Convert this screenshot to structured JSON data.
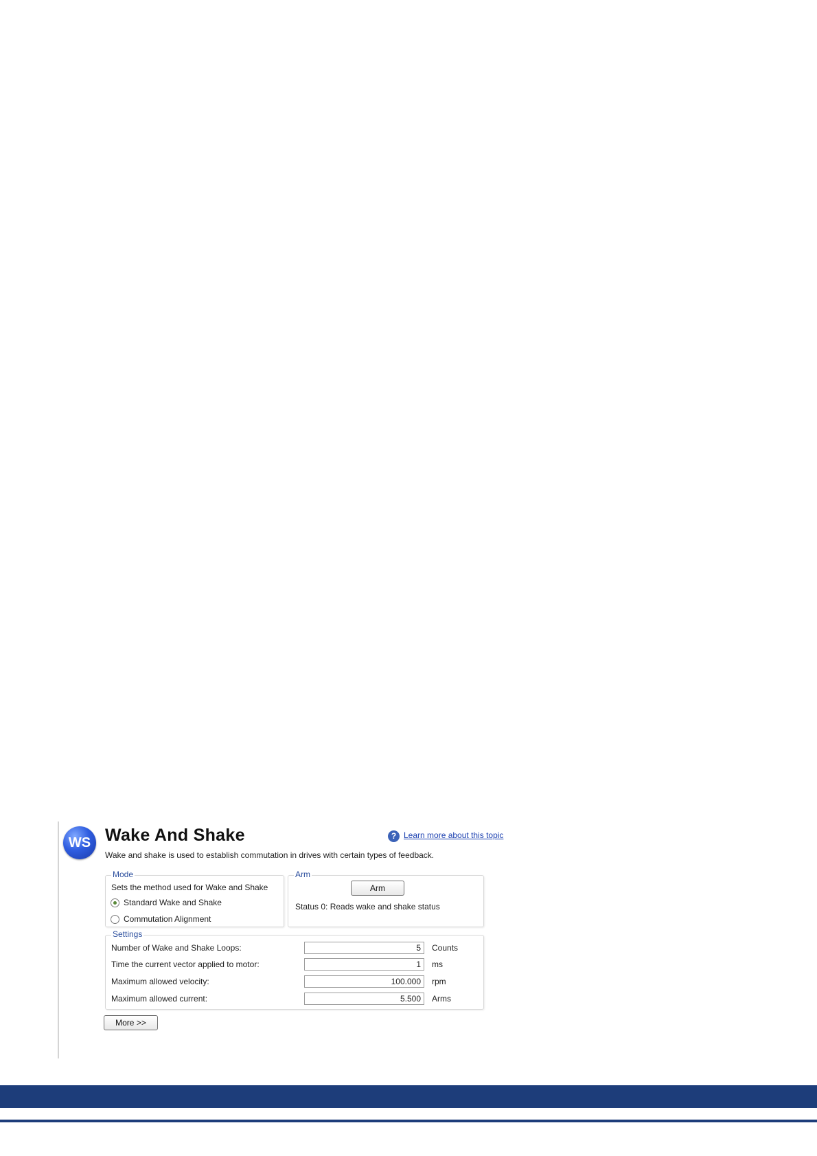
{
  "header": {
    "logo_text": "WS",
    "title": "Wake And Shake",
    "help_link": "Learn more about this topic",
    "description": "Wake and shake is used to establish commutation in drives with certain types of feedback."
  },
  "mode": {
    "legend": "Mode",
    "caption": "Sets the method used for Wake and Shake",
    "options": [
      {
        "label": "Standard Wake and Shake",
        "selected": true
      },
      {
        "label": "Commutation Alignment",
        "selected": false
      }
    ]
  },
  "arm": {
    "legend": "Arm",
    "button_label": "Arm",
    "status": "Status 0: Reads wake and shake status"
  },
  "settings": {
    "legend": "Settings",
    "rows": [
      {
        "label": "Number of Wake and Shake Loops:",
        "value": "5",
        "unit": "Counts"
      },
      {
        "label": "Time the current vector applied to motor:",
        "value": "1",
        "unit": "ms"
      },
      {
        "label": "Maximum allowed velocity:",
        "value": "100.000",
        "unit": "rpm"
      },
      {
        "label": "Maximum allowed current:",
        "value": "5.500",
        "unit": "Arms"
      }
    ]
  },
  "more_button": "More >>",
  "colors": {
    "footer": "#1d3d7a",
    "legend": "#2c4f9e",
    "link": "#1a3fb0"
  }
}
